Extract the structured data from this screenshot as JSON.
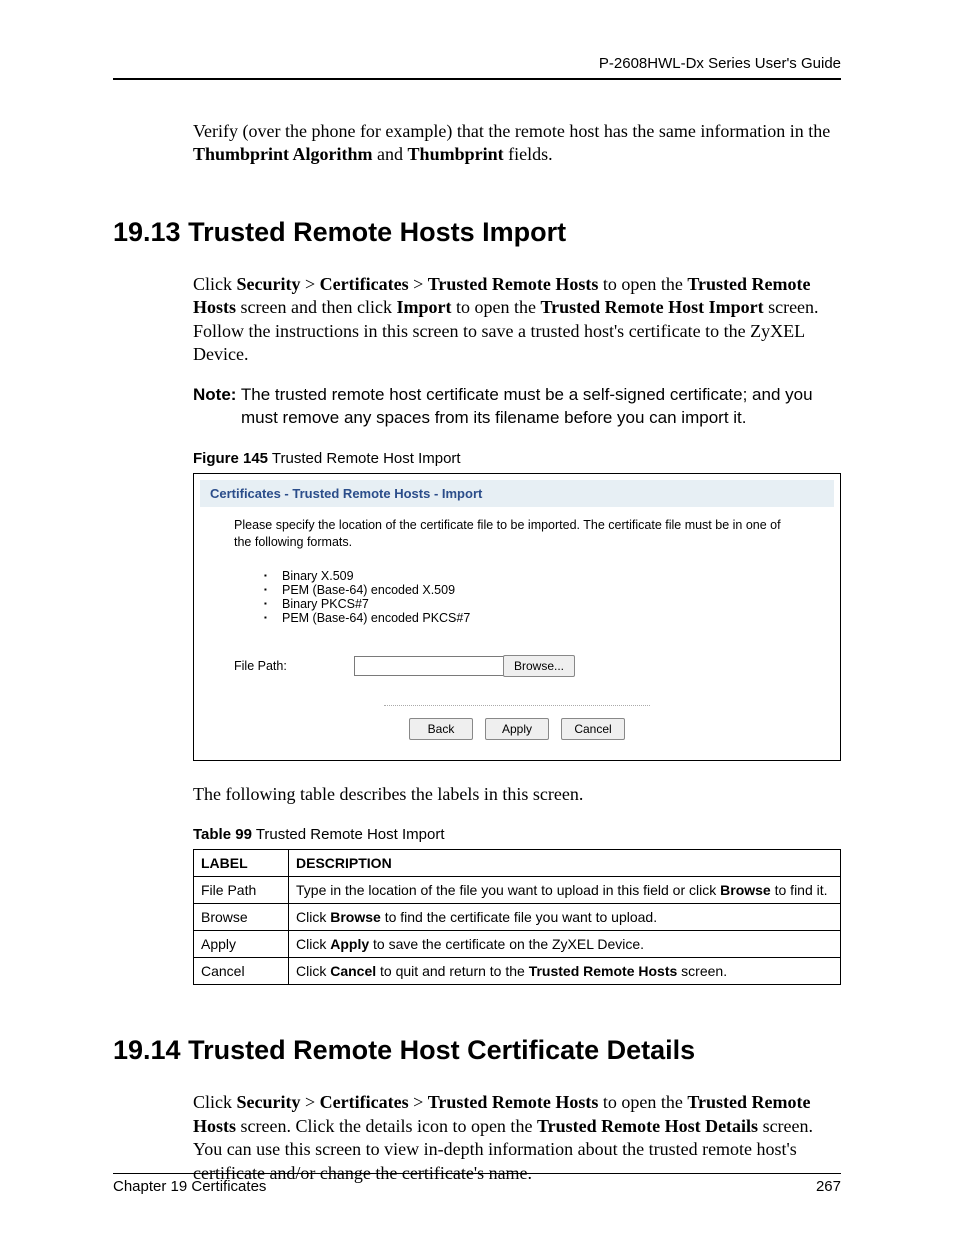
{
  "header": {
    "guide_title": "P-2608HWL-Dx Series User's Guide"
  },
  "intro": {
    "verify_line1": "Verify (over the phone for example) that the remote host has the same information in the ",
    "thumbprint_algo": "Thumbprint Algorithm",
    "and": " and ",
    "thumbprint": "Thumbprint",
    "fields": " fields."
  },
  "section1": {
    "heading": "19.13  Trusted Remote Hosts Import",
    "para_pre": "Click ",
    "bc1": "Security",
    "gt1": " > ",
    "bc2": "Certificates",
    "gt2": " > ",
    "bc3": "Trusted Remote Hosts",
    "mid1": " to open the ",
    "trh": "Trusted Remote Hosts",
    "mid2": " screen and then click ",
    "import": "Import",
    "mid3": " to open the ",
    "trhi": "Trusted Remote Host Import",
    "mid4": " screen. Follow the instructions in this screen to save a trusted host's certificate to the ZyXEL Device.",
    "note_label": "Note:",
    "note_line1": " The trusted remote host certificate must be a self-signed certificate; and you",
    "note_line2": "must remove any spaces from its filename before you can import it.",
    "fig_num": "Figure 145",
    "fig_title": "   Trusted Remote Host Import"
  },
  "figure": {
    "title": "Certificates - Trusted Remote Hosts - Import",
    "instruction": "Please specify the location of the certificate file to be imported. The certificate file must be in one of the following formats.",
    "formats": [
      "Binary X.509",
      "PEM (Base-64) encoded X.509",
      "Binary PKCS#7",
      "PEM (Base-64) encoded PKCS#7"
    ],
    "file_path_label": "File Path:",
    "browse": "Browse...",
    "back": "Back",
    "apply": "Apply",
    "cancel": "Cancel"
  },
  "table_intro": "The following table describes the labels in this screen.",
  "table_caption_num": "Table 99",
  "table_caption_title": "   Trusted Remote Host Import",
  "table": {
    "col_label": "LABEL",
    "col_desc": "DESCRIPTION",
    "rows": [
      {
        "label": "File Path",
        "desc_pre": "Type in the location of the file you want to upload in this field or click ",
        "desc_bold": "Browse",
        "desc_post": " to find it."
      },
      {
        "label": "Browse",
        "desc_pre": "Click ",
        "desc_bold": "Browse",
        "desc_post": " to find the certificate file you want to upload."
      },
      {
        "label": "Apply",
        "desc_pre": "Click ",
        "desc_bold": "Apply",
        "desc_post": " to save the certificate on the ZyXEL Device."
      },
      {
        "label": "Cancel",
        "desc_pre": "Click ",
        "desc_bold": "Cancel",
        "desc_mid": " to quit and return to the ",
        "desc_bold2": "Trusted Remote Hosts",
        "desc_post": " screen."
      }
    ]
  },
  "section2": {
    "heading": "19.14  Trusted Remote Host Certificate Details",
    "para_pre": "Click ",
    "bc1": "Security",
    "gt1": " > ",
    "bc2": "Certificates",
    "gt2": " > ",
    "bc3": "Trusted Remote Hosts",
    "mid1": " to open the ",
    "trh": "Trusted Remote Hosts",
    "mid2": " screen. Click the details icon to open the ",
    "trhd": "Trusted Remote Host Details",
    "mid3": " screen. You can use this screen to view in-depth information about the trusted remote host's certificate and/or change the certificate's name."
  },
  "footer": {
    "chapter": "Chapter 19 Certificates",
    "page": "267"
  }
}
